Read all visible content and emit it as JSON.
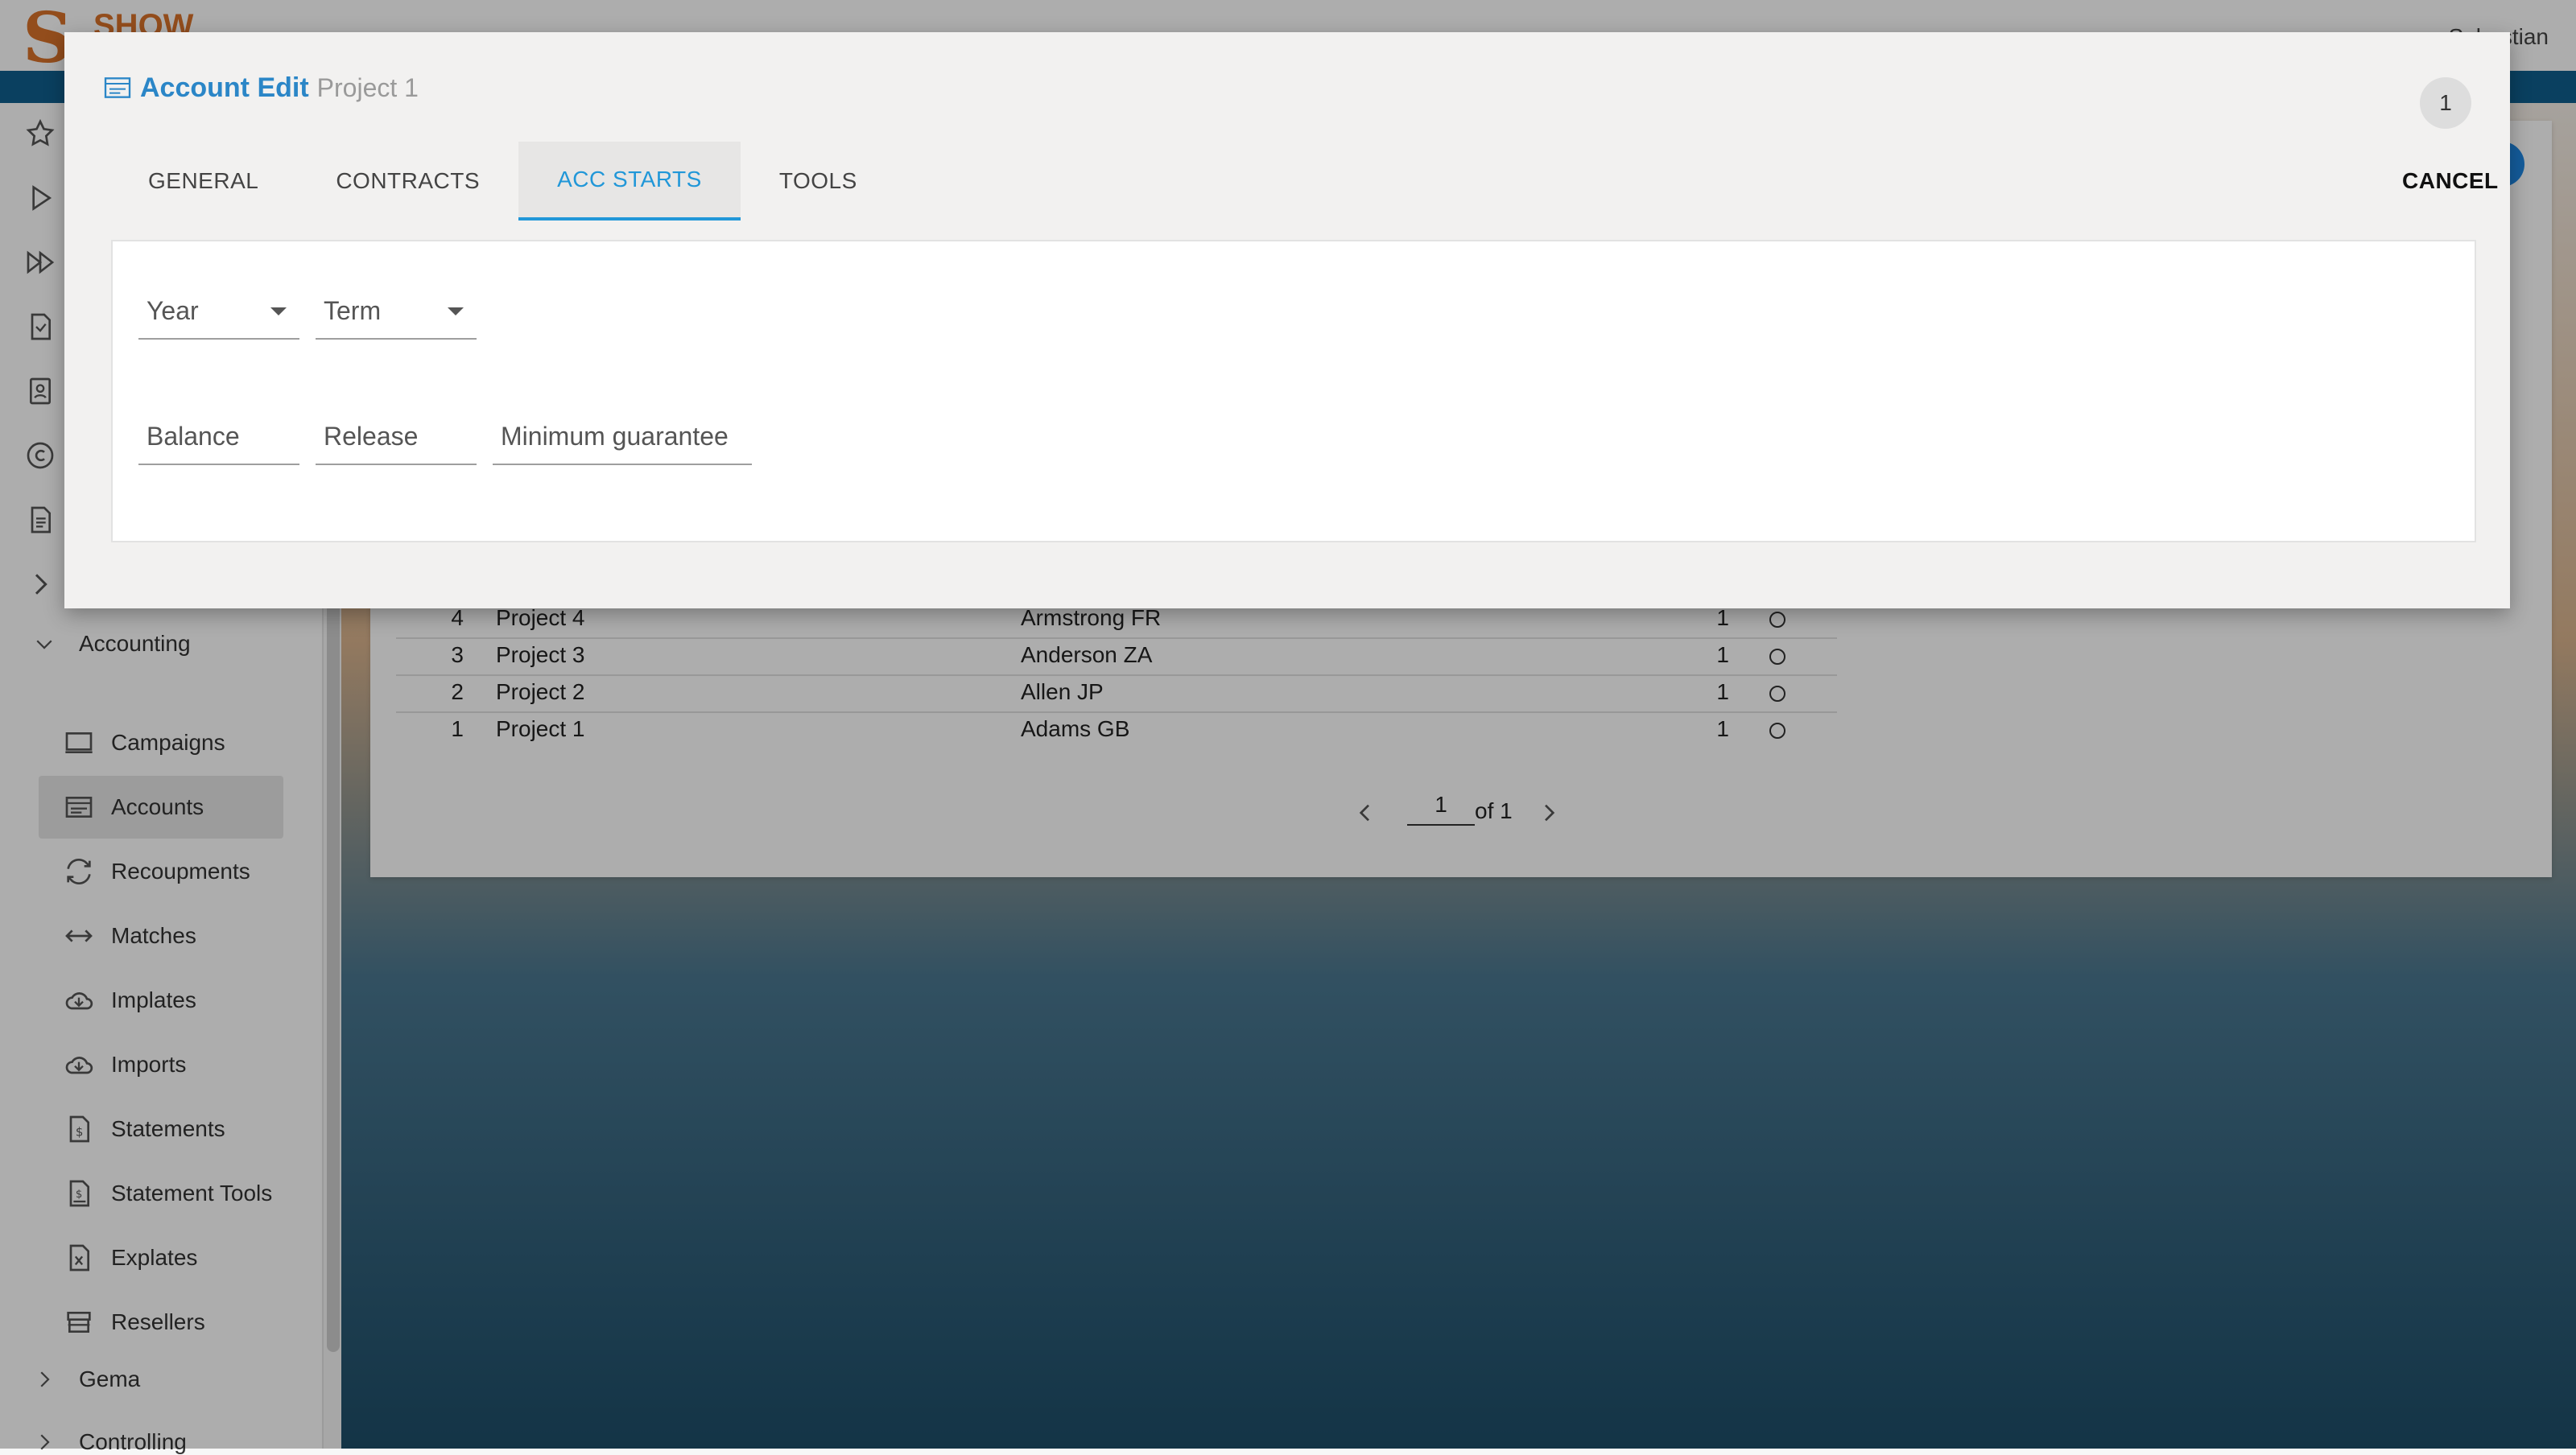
{
  "app": {
    "logo_text": "SHOW",
    "user_name": "Sebastian"
  },
  "sidebar": {
    "groups": {
      "accounting": "Accounting",
      "gema": "Gema",
      "controlling": "Controlling"
    },
    "items": [
      {
        "label": "Campaigns",
        "icon": "monitor-icon"
      },
      {
        "label": "Accounts",
        "icon": "account-card-icon"
      },
      {
        "label": "Recoupments",
        "icon": "refresh-icon"
      },
      {
        "label": "Matches",
        "icon": "arrows-horizontal-icon"
      },
      {
        "label": "Implates",
        "icon": "cloud-download-icon"
      },
      {
        "label": "Imports",
        "icon": "cloud-download-icon"
      },
      {
        "label": "Statements",
        "icon": "dollar-document-icon"
      },
      {
        "label": "Statement Tools",
        "icon": "dollar-tools-icon"
      },
      {
        "label": "Explates",
        "icon": "excel-document-icon"
      },
      {
        "label": "Resellers",
        "icon": "storefront-icon"
      }
    ]
  },
  "table": {
    "rows": [
      {
        "num": "4",
        "project": "Project 4",
        "name": "Armstrong FR",
        "count": "1"
      },
      {
        "num": "3",
        "project": "Project 3",
        "name": "Anderson ZA",
        "count": "1"
      },
      {
        "num": "2",
        "project": "Project 2",
        "name": "Allen JP",
        "count": "1"
      },
      {
        "num": "1",
        "project": "Project 1",
        "name": "Adams GB",
        "count": "1"
      }
    ],
    "pagination": {
      "page": "1",
      "of_label": "of 1"
    }
  },
  "dialog": {
    "title": "Account Edit",
    "subtitle": "Project 1",
    "badge_count": "1",
    "tabs": [
      "GENERAL",
      "CONTRACTS",
      "ACC STARTS",
      "TOOLS"
    ],
    "active_tab": "ACC STARTS",
    "cancel_label": "CANCEL",
    "fields": {
      "year": "Year",
      "term": "Term",
      "balance": "Balance",
      "release": "Release",
      "minimum_guarantee": "Minimum guarantee"
    }
  },
  "colors": {
    "accent": "#2197d8",
    "title_blue": "#2b86c7",
    "brand_orange": "#d9722a",
    "nav_blue": "#0f5f8e"
  }
}
